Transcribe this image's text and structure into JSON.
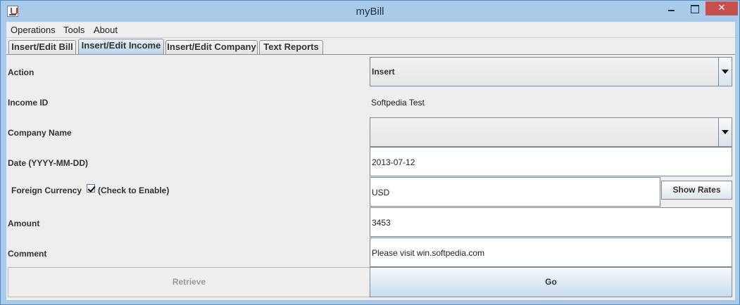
{
  "window": {
    "title": "myBill",
    "close_glyph": "✕"
  },
  "menu": [
    "Operations",
    "Tools",
    "About"
  ],
  "tabs": [
    "Insert/Edit Bill",
    "Insert/Edit Income",
    "Insert/Edit Company",
    "Text Reports"
  ],
  "active_tab": "Insert/Edit Income",
  "form": {
    "action_label": "Action",
    "action_value": "Insert",
    "income_id_label": "Income ID",
    "income_id_value": "Softpedia Test",
    "company_label": "Company Name",
    "company_value": "",
    "date_label": "Date (YYYY-MM-DD)",
    "date_value": "2013-07-12",
    "currency_label": "Foreign Currency",
    "currency_checkbox_label": "(Check to Enable)",
    "currency_checked": true,
    "currency_value": "USD",
    "show_rates_label": "Show Rates",
    "amount_label": "Amount",
    "amount_value": "3453",
    "comment_label": "Comment",
    "comment_value": "Please visit win.softpedia.com",
    "retrieve_label": "Retrieve",
    "go_label": "Go"
  }
}
